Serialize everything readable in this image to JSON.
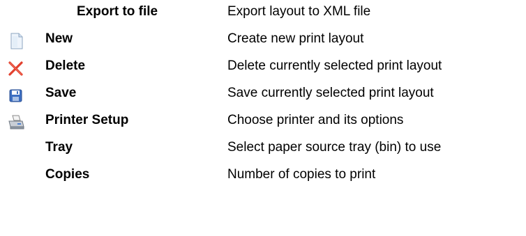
{
  "rows": [
    {
      "label": "Export to file",
      "description": "Export layout to XML file",
      "icon": ""
    },
    {
      "label": "New",
      "description": "Create new print layout",
      "icon": "new-document-icon"
    },
    {
      "label": "Delete",
      "description": "Delete currently selected print layout",
      "icon": "delete-x-icon"
    },
    {
      "label": "Save",
      "description": "Save currently selected print layout",
      "icon": "floppy-disk-icon"
    },
    {
      "label": "Printer Setup",
      "description": "Choose printer and its options",
      "icon": "printer-icon"
    },
    {
      "label": "Tray",
      "description": "Select paper source tray (bin) to use",
      "icon": ""
    },
    {
      "label": "Copies",
      "description": "Number of copies to print",
      "icon": ""
    }
  ],
  "colors": {
    "delete_red": "#e2402e",
    "floppy_blue": "#3d6fc2"
  }
}
